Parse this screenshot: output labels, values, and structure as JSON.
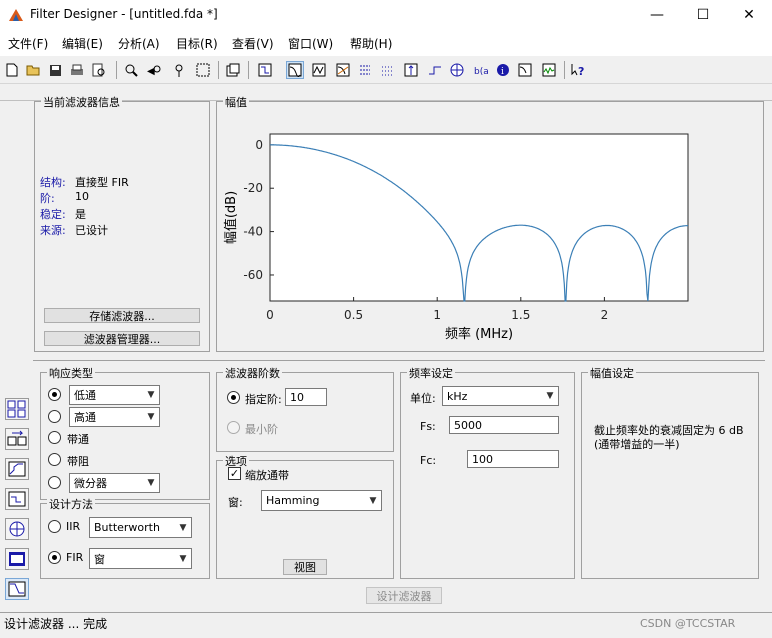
{
  "window": {
    "title": "Filter Designer -  [untitled.fda *]"
  },
  "menu": [
    "文件(F)",
    "编辑(E)",
    "分析(A)",
    "目标(R)",
    "查看(V)",
    "窗口(W)",
    "帮助(H)"
  ],
  "info": {
    "group_title": "当前滤波器信息",
    "rows": [
      {
        "label": "结构:",
        "value": "直接型 FIR"
      },
      {
        "label": "阶:",
        "value": "10"
      },
      {
        "label": "稳定:",
        "value": "是"
      },
      {
        "label": "来源:",
        "value": "已设计"
      }
    ],
    "store_btn": "存储滤波器...",
    "manager_btn": "滤波器管理器..."
  },
  "plot": {
    "group_title": "幅值",
    "xlabel": "频率 (MHz)",
    "ylabel": "幅值(dB)",
    "xticks": [
      "0",
      "0.5",
      "1",
      "1.5",
      "2"
    ],
    "yticks": [
      "0",
      "-20",
      "-40",
      "-60"
    ]
  },
  "chart_data": {
    "type": "line",
    "title": "",
    "xlabel": "频率 (MHz)",
    "ylabel": "幅值(dB)",
    "xlim": [
      0,
      2.5
    ],
    "ylim": [
      -72,
      5
    ],
    "series": [
      {
        "values": []
      }
    ],
    "color": "#3b7fb6"
  },
  "response": {
    "group_title": "响应类型",
    "options": [
      {
        "label": "低通",
        "combo": true,
        "checked": true
      },
      {
        "label": "高通",
        "combo": true,
        "checked": false
      },
      {
        "label": "带通",
        "combo": false,
        "checked": false
      },
      {
        "label": "带阻",
        "combo": false,
        "checked": false
      },
      {
        "label": "微分器",
        "combo": true,
        "checked": false
      }
    ]
  },
  "method": {
    "group_title": "设计方法",
    "iir_label": "IIR",
    "iir_value": "Butterworth",
    "fir_label": "FIR",
    "fir_value": "窗"
  },
  "order": {
    "group_title": "滤波器阶数",
    "specify_label": "指定阶:",
    "specify_value": "10",
    "min_label": "最小阶"
  },
  "options": {
    "group_title": "选项",
    "scale_label": "缩放通带",
    "window_label": "窗:",
    "window_value": "Hamming",
    "view_btn": "视图"
  },
  "freq": {
    "group_title": "频率设定",
    "unit_label": "单位:",
    "unit_value": "kHz",
    "fs_label": "Fs:",
    "fs_value": "5000",
    "fc_label": "Fc:",
    "fc_value": "100"
  },
  "mag": {
    "group_title": "幅值设定",
    "text1": "截止频率处的衰减固定为 6 dB",
    "text2": "(通带增益的一半)"
  },
  "design_btn": "设计滤波器",
  "status": {
    "text": "设计滤波器 ... 完成",
    "watermark": "CSDN @TCCSTAR"
  }
}
